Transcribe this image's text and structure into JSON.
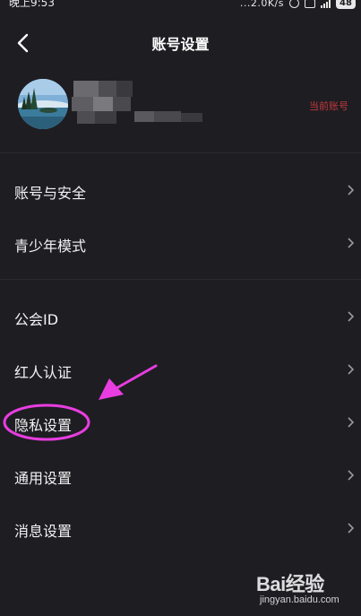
{
  "status_bar": {
    "time": "晚上9:53",
    "network_speed": "...2.0K/s",
    "battery": "48"
  },
  "header": {
    "back_icon": "chevron-left-icon",
    "title": "账号设置"
  },
  "account": {
    "username": "",
    "current_tag": "当前账号"
  },
  "menu": {
    "items": [
      {
        "label": "账号与安全",
        "icon": "chevron-right-icon"
      },
      {
        "label": "青少年模式",
        "icon": "chevron-right-icon"
      },
      {
        "label": "公会ID",
        "icon": "chevron-right-icon"
      },
      {
        "label": "红人认证",
        "icon": "chevron-right-icon"
      },
      {
        "label": "隐私设置",
        "icon": "chevron-right-icon"
      },
      {
        "label": "通用设置",
        "icon": "chevron-right-icon"
      },
      {
        "label": "消息设置",
        "icon": "chevron-right-icon"
      }
    ]
  },
  "annotation": {
    "color": "#e83de0"
  },
  "watermark": {
    "brand": "Bai经验",
    "url": "jingyan.baidu.com"
  },
  "colors": {
    "background": "#1e1d22",
    "text": "#f2f2f2",
    "accent_red": "#c0393b",
    "divider": "#2c2b31"
  }
}
